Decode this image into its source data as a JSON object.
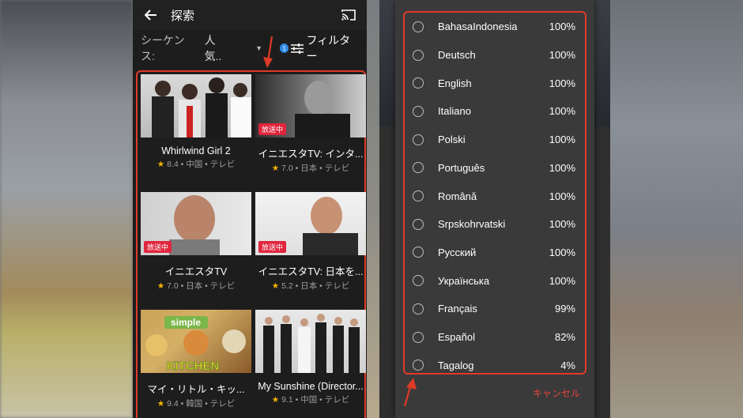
{
  "left_screen": {
    "title": "探索",
    "filter_bar": {
      "sequence_label": "シーケンス:",
      "sequence_value": "人気..",
      "filter_count": "1",
      "filter_label": "フィルター"
    },
    "cards": [
      {
        "title": "Whirlwind Girl 2",
        "rating": "8.4",
        "country": "中国",
        "type": "テレビ",
        "live": ""
      },
      {
        "title": "イニエスタTV: インタ...",
        "rating": "7.0",
        "country": "日本",
        "type": "テレビ",
        "live": "放送中"
      },
      {
        "title": "イニエスタTV",
        "rating": "7.0",
        "country": "日本",
        "type": "テレビ",
        "live": "放送中"
      },
      {
        "title": "イニエスタTV: 日本を...",
        "rating": "5.2",
        "country": "日本",
        "type": "テレビ",
        "live": "放送中"
      },
      {
        "title": "マイ・リトル・キッ...",
        "rating": "9.4",
        "country": "韓国",
        "type": "テレビ",
        "live": "",
        "art_text_1": "simple",
        "art_text_2": "KITCHEN"
      },
      {
        "title": "My Sunshine (Director...",
        "rating": "9.1",
        "country": "中国",
        "type": "テレビ",
        "live": ""
      }
    ]
  },
  "right_screen": {
    "languages": [
      {
        "name": "BahasaIndonesia",
        "percent": "100%"
      },
      {
        "name": "Deutsch",
        "percent": "100%"
      },
      {
        "name": "English",
        "percent": "100%"
      },
      {
        "name": "Italiano",
        "percent": "100%"
      },
      {
        "name": "Polski",
        "percent": "100%"
      },
      {
        "name": "Português",
        "percent": "100%"
      },
      {
        "name": "Română",
        "percent": "100%"
      },
      {
        "name": "Srpskohrvatski",
        "percent": "100%"
      },
      {
        "name": "Русский",
        "percent": "100%"
      },
      {
        "name": "Українська",
        "percent": "100%"
      },
      {
        "name": "Français",
        "percent": "99%"
      },
      {
        "name": "Español",
        "percent": "82%"
      },
      {
        "name": "Tagalog",
        "percent": "4%"
      }
    ],
    "cancel_label": "キャンセル"
  },
  "colors": {
    "highlight_border": "#e03a28",
    "live_badge": "#e0263e",
    "filter_badge": "#2f8be6",
    "cancel_text": "#e8453c",
    "star": "#f5b400"
  }
}
